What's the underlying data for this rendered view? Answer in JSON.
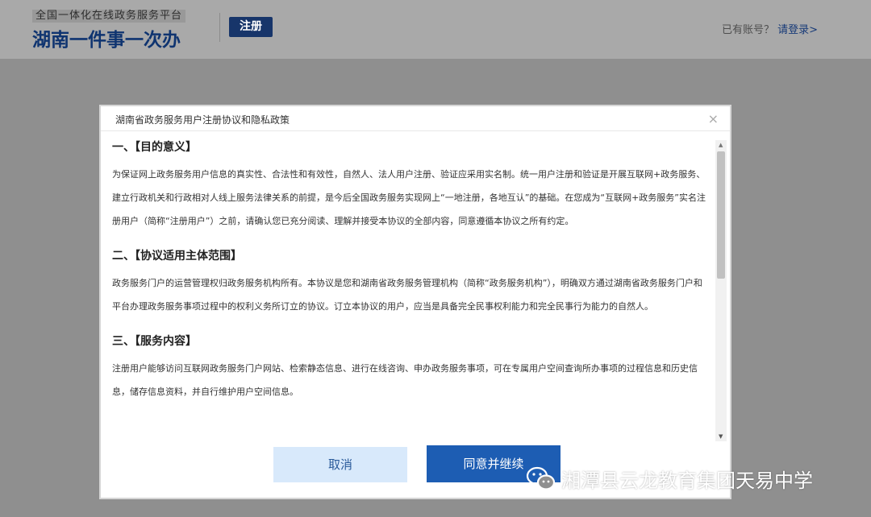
{
  "header": {
    "brand_sub": "全国一体化在线政务服务平台",
    "brand_main": "湖南一件事一次办",
    "register_badge": "注册",
    "account_hint": "已有账号？",
    "login_link": "请登录>"
  },
  "dialog": {
    "title": "湖南省政务服务用户注册协议和隐私政策",
    "close_symbol": "×",
    "sections": [
      {
        "heading": "一、【目的意义】",
        "body": "为保证网上政务服务用户信息的真实性、合法性和有效性，自然人、法人用户注册、验证应采用实名制。统一用户注册和验证是开展互联网+政务服务、建立行政机关和行政相对人线上服务法律关系的前提，是今后全国政务服务实现网上“一地注册，各地互认”的基础。在您成为“互联网+政务服务”实名注册用户（简称“注册用户”）之前，请确认您已充分阅读、理解并接受本协议的全部内容，同意遵循本协议之所有约定。"
      },
      {
        "heading": "二、【协议适用主体范围】",
        "body": "政务服务门户的运营管理权归政务服务机构所有。本协议是您和湖南省政务服务管理机构（简称“政务服务机构”），明确双方通过湖南省政务服务门户和平台办理政务服务事项过程中的权利义务所订立的协议。订立本协议的用户，应当是具备完全民事权利能力和完全民事行为能力的自然人。"
      },
      {
        "heading": "三、【服务内容】",
        "body": "注册用户能够访问互联网政务服务门户网站、检索静态信息、进行在线咨询、申办政务服务事项，可在专属用户空间查询所办事项的过程信息和历史信息，储存信息资料，并自行维护用户空间信息。"
      }
    ],
    "cancel_label": "取消",
    "agree_label": "同意并继续"
  },
  "watermark": {
    "text": "湘潭县云龙教育集团天易中学",
    "icon": "wechat-icon"
  },
  "colors": {
    "brand_blue": "#0f3470",
    "agree_button": "#1d5db3",
    "cancel_button": "#d8e9fb",
    "overlay": "#8f8f8f"
  }
}
